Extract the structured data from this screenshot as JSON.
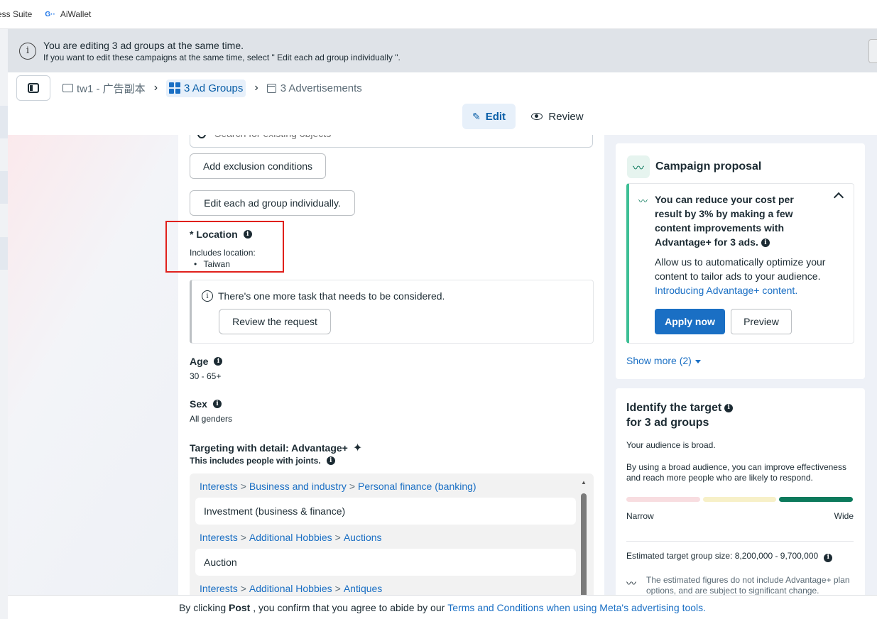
{
  "bookmarks": [
    {
      "label": "ess Suite"
    },
    {
      "label": "AiWallet",
      "icon": "wallet-icon"
    }
  ],
  "banner": {
    "title": "You are editing 3 ad groups at the same time.",
    "subtitle": "If you want to edit these campaigns at the same time, select \" Edit each ad group individually \"."
  },
  "breadcrumb": {
    "campaign": "tw1 - 广告副本",
    "ad_groups": "3 Ad Groups",
    "ads": "3 Advertisements"
  },
  "modes": {
    "edit": "Edit",
    "review": "Review",
    "active": "edit"
  },
  "form": {
    "search_placeholder": "Search for existing objects",
    "exclusion_button": "Add exclusion conditions",
    "individual_button": "Edit each ad group individually.",
    "location": {
      "label": "* Location",
      "includes": "Includes location:",
      "items": [
        "Taiwan"
      ]
    },
    "task": {
      "text": "There's one more task that needs to be considered.",
      "button": "Review the request"
    },
    "age": {
      "label": "Age",
      "value": "30 - 65+"
    },
    "sex": {
      "label": "Sex",
      "value": "All genders"
    },
    "targeting": {
      "label": "Targeting with detail: Advantage+",
      "sub": "This includes people with joints.",
      "groups": [
        {
          "path": [
            "Interests",
            "Business and industry",
            "Personal finance (banking)"
          ],
          "item": "Investment (business & finance)"
        },
        {
          "path": [
            "Interests",
            "Additional Hobbies",
            "Auctions"
          ],
          "item": "Auction"
        },
        {
          "path": [
            "Interests",
            "Additional Hobbies",
            "Antiques"
          ],
          "item": ""
        }
      ]
    }
  },
  "proposal": {
    "title": "Campaign proposal",
    "suggestion_title": "You can reduce your cost per result by 3% by making a few content improvements with Advantage+ for 3 ads.",
    "body": "Allow us to automatically optimize your content to tailor ads to your audience.",
    "link": "Introducing Advantage+ content.",
    "apply": "Apply now",
    "preview": "Preview",
    "show_more": "Show more (2)"
  },
  "target": {
    "title_line1": "Identify the target",
    "title_line2": "for 3 ad groups",
    "broad": "Your audience is broad.",
    "advice": "By using a broad audience, you can improve effectiveness and reach more people who are likely to respond.",
    "narrow": "Narrow",
    "wide": "Wide",
    "gauge_level": "wide",
    "size": "Estimated target group size: 8,200,000 - 9,700,000",
    "note": "The estimated figures do not include Advantage+ plan options, and are subject to significant change."
  },
  "footer": {
    "prefix": "By clicking",
    "post": "Post",
    "middle": ", you confirm that you agree to abide by our",
    "link": "Terms and Conditions when using Meta's advertising tools."
  },
  "colors": {
    "accent": "#1a6fc4",
    "highlight_box": "#e0201c",
    "green": "#0c7a5c"
  }
}
